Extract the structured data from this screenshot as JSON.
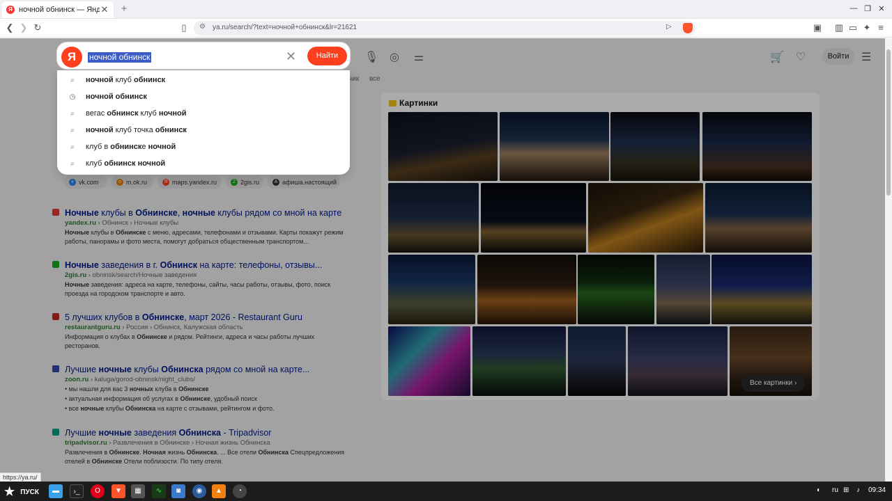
{
  "browser": {
    "tab_title": "ночной обнинск — Яндекс:",
    "tab_favicon": "Я",
    "url": "ya.ru/search/?text=ночной+обнинск&lr=21621",
    "status_url": "https://ya.ru/"
  },
  "search": {
    "logo": "Я",
    "query": "ночной обнинск",
    "button": "Найти"
  },
  "suggestions": [
    {
      "icon": "search-icon",
      "parts": [
        [
          "b",
          "ночной"
        ],
        [
          "n",
          " клуб "
        ],
        [
          "b",
          "обнинск"
        ]
      ]
    },
    {
      "icon": "history-icon",
      "parts": [
        [
          "b",
          "ночной обнинск"
        ]
      ]
    },
    {
      "icon": "search-icon",
      "parts": [
        [
          "n",
          "вегас "
        ],
        [
          "b",
          "обнинск"
        ],
        [
          "n",
          " клуб "
        ],
        [
          "b",
          "ночной"
        ]
      ]
    },
    {
      "icon": "search-icon",
      "parts": [
        [
          "b",
          "ночной"
        ],
        [
          "n",
          " клуб точка "
        ],
        [
          "b",
          "обнинск"
        ]
      ]
    },
    {
      "icon": "search-icon",
      "parts": [
        [
          "n",
          "клуб в "
        ],
        [
          "b",
          "обнинск"
        ],
        [
          "n",
          "е "
        ],
        [
          "b",
          "ночной"
        ]
      ]
    },
    {
      "icon": "search-icon",
      "parts": [
        [
          "n",
          "клуб "
        ],
        [
          "b",
          "обнинск"
        ],
        [
          "n",
          " "
        ],
        [
          "b",
          "ночной"
        ]
      ]
    }
  ],
  "header": {
    "login": "Войти",
    "tabs": [
      "учик",
      "все"
    ]
  },
  "sites": [
    {
      "label": "vk.com",
      "color": "#2787f5",
      "glyph": "к"
    },
    {
      "label": "m.ok.ru",
      "color": "#ee8208",
      "glyph": "o"
    },
    {
      "label": "maps.yandex.ru",
      "color": "#fc3f1d",
      "glyph": "Я"
    },
    {
      "label": "2gis.ru",
      "color": "#19aa1e",
      "glyph": "2"
    },
    {
      "label": "афиша.настоящий",
      "color": "#333333",
      "glyph": "А"
    }
  ],
  "results": [
    {
      "icon_color": "#e53935",
      "title": [
        [
          "b",
          "Ночные"
        ],
        [
          "n",
          " клубы в "
        ],
        [
          "b",
          "Обнинске"
        ],
        [
          "n",
          ", "
        ],
        [
          "b",
          "ночные"
        ],
        [
          "n",
          " клубы рядом со мной на карте"
        ]
      ],
      "domain": "yandex.ru",
      "path": " › Обнинск › Ночные клубы",
      "snippet": [
        [
          "b",
          "Ночные"
        ],
        [
          "n",
          " клубы в "
        ],
        [
          "b",
          "Обнинске"
        ],
        [
          "n",
          " с меню, адресами, телефонами и отзывами. Карты покажут режим работы, панорамы и фото места, помогут добраться общественным транспортом..."
        ]
      ]
    },
    {
      "icon_color": "#19aa1e",
      "title": [
        [
          "b",
          "Ночные"
        ],
        [
          "n",
          " заведения в г. "
        ],
        [
          "b",
          "Обнинск"
        ],
        [
          "n",
          " на карте: телефоны, отзывы..."
        ]
      ],
      "domain": "2gis.ru",
      "path": " › obninsk/search/Ночные заведения",
      "snippet": [
        [
          "b",
          "Ночные"
        ],
        [
          "n",
          " заведения: адреса на карте, телефоны, сайты, часы работы, отзывы, фото, поиск проезда на городском транспорте и авто."
        ]
      ]
    },
    {
      "icon_color": "#c62828",
      "title": [
        [
          "n",
          "5 лучших клубов в "
        ],
        [
          "b",
          "Обнинске"
        ],
        [
          "n",
          ", март 2026 - Restaurant Guru"
        ]
      ],
      "domain": "restaurantguru.ru",
      "path": " › Россия › Обнинск, Калужская область",
      "snippet": [
        [
          "n",
          "Информация о клубах в "
        ],
        [
          "b",
          "Обнинске"
        ],
        [
          "n",
          " и рядом. Рейтинги, адреса и часы работы лучших ресторанов."
        ]
      ]
    },
    {
      "icon_color": "#3949ab",
      "title": [
        [
          "n",
          "Лучшие "
        ],
        [
          "b",
          "ночные"
        ],
        [
          "n",
          " клубы "
        ],
        [
          "b",
          "Обнинска"
        ],
        [
          "n",
          " рядом со мной на карте..."
        ]
      ],
      "domain": "zoon.ru",
      "path": " › kaluga/gorod-obninsk/night_clubs/",
      "bullets": [
        [
          [
            "n",
            "мы нашли для вас 3 "
          ],
          [
            "b",
            "ночных"
          ],
          [
            "n",
            " клуба в "
          ],
          [
            "b",
            "Обнинске"
          ]
        ],
        [
          [
            "n",
            "актуальная информация об услугах в "
          ],
          [
            "b",
            "Обнинске"
          ],
          [
            "n",
            ", удобный поиск"
          ]
        ],
        [
          [
            "n",
            "все "
          ],
          [
            "b",
            "ночные"
          ],
          [
            "n",
            " клубы "
          ],
          [
            "b",
            "Обнинска"
          ],
          [
            "n",
            " на карте с отзывами, рейтингом и фото."
          ]
        ]
      ]
    },
    {
      "icon_color": "#00a680",
      "title": [
        [
          "n",
          "Лучшие "
        ],
        [
          "b",
          "ночные"
        ],
        [
          "n",
          " заведения "
        ],
        [
          "b",
          "Обнинска"
        ],
        [
          "n",
          " - Tripadvisor"
        ]
      ],
      "domain": "tripadvisor.ru",
      "path": " › Развлечения в Обнинске › Ночная жизнь Обнинска",
      "snippet": [
        [
          "n",
          "Развлечения в "
        ],
        [
          "b",
          "Обнинске"
        ],
        [
          "n",
          ". "
        ],
        [
          "b",
          "Ночная"
        ],
        [
          "n",
          " жизнь "
        ],
        [
          "b",
          "Обнинска"
        ],
        [
          "n",
          ". ... Все отели "
        ],
        [
          "b",
          "Обнинска"
        ],
        [
          "n",
          " Спецпредложения отелей в "
        ],
        [
          "b",
          "Обнинске"
        ],
        [
          "n",
          " Отели поблизости. По типу отеля."
        ]
      ]
    }
  ],
  "images": {
    "title": "Картинки",
    "all_button": "Все картинки",
    "thumbs": [
      {
        "bg": "linear-gradient(170deg,#0c1020 0%,#1a1f30 50%,#5a4020 70%,#18140e 100%)"
      },
      {
        "bg": "linear-gradient(180deg,#0b1530 0%,#1f3550 40%,#a08060 60%,#201810 100%)"
      },
      {
        "bg": "linear-gradient(180deg,#0a0a14 0%,#203050 45%,#3a3020 75%,#14120a 100%)"
      },
      {
        "bg": "linear-gradient(180deg,#050810 0%,#1a2a4a 45%,#4a3020 80%,#100c08 100%)"
      },
      {
        "bg": "linear-gradient(180deg,#101830 0%,#203048 50%,#6a5530 75%,#181410 100%)"
      },
      {
        "bg": "linear-gradient(180deg,#04060c 0%,#0a1020 55%,#806030 70%,#080808 100%)"
      },
      {
        "bg": "linear-gradient(160deg,#1a1208 0%,#3a2810 40%,#c08020 60%,#2a1a08 100%)"
      },
      {
        "bg": "linear-gradient(180deg,#0a1a30 0%,#1a3050 45%,#806040 65%,#201810 100%)"
      },
      {
        "bg": "linear-gradient(180deg,#0a1838 0%,#1a3868 40%,#5a6040 70%,#2a2010 100%)"
      },
      {
        "bg": "linear-gradient(180deg,#0e0a08 0%,#302010 45%,#a06020 65%,#281808 100%)"
      },
      {
        "bg": "linear-gradient(180deg,#060a06 0%,#103010 40%,#2a6a20 55%,#080a08 100%)"
      },
      {
        "bg": "linear-gradient(180deg,#202a48 0%,#404868 45%,#806850 70%,#10141c 100%)"
      },
      {
        "bg": "linear-gradient(180deg,#0a1440 0%,#1a2a70 45%,#8a7030 70%,#181810 100%)"
      },
      {
        "bg": "linear-gradient(135deg,#101060 0%,#30a0b0 35%,#b020a0 60%,#201040 100%)"
      },
      {
        "bg": "linear-gradient(180deg,#10183a 0%,#2a3a5a 40%,#305a30 60%,#080c10 100%)"
      },
      {
        "bg": "linear-gradient(180deg,#1a2a48 0%,#2a3858 50%,#1a1a20 80%,#0a0a0e 100%)"
      },
      {
        "bg": "linear-gradient(180deg,#1a2040 0%,#3a4068 45%,#504050 70%,#141418 100%)"
      },
      {
        "bg": "linear-gradient(180deg,#3a2818 0%,#6a4828 45%,#302018 75%,#181008 100%)"
      }
    ]
  },
  "taskbar": {
    "start": "ПУСК",
    "lang": "ru",
    "time": "09:34"
  }
}
